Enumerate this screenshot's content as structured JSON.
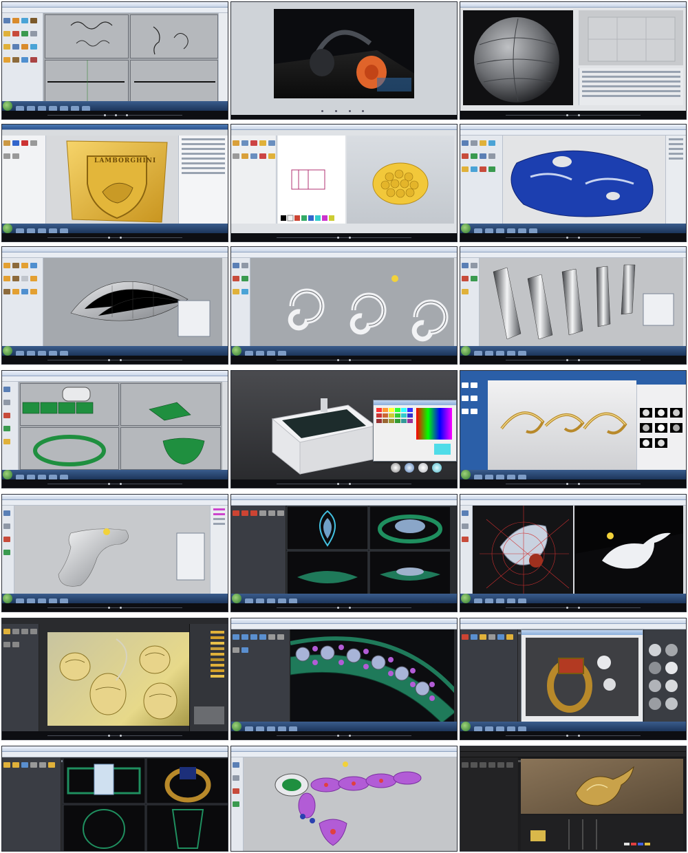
{
  "collage": {
    "columns": 3,
    "rows": 7,
    "tiles": [
      {
        "app": "Rhino",
        "subject": "ornament curves",
        "viewport_background": "#b6b8bb"
      },
      {
        "app": "Render window",
        "subject": "headphones",
        "viewport_background": "#0b0c0f"
      },
      {
        "app": "ZBrush",
        "subject": "sculpted sphere",
        "viewport_background": "#1a1a1c"
      },
      {
        "app": "ArtCAM",
        "subject": "relief logo",
        "viewport_background": "#d9dcdf",
        "embossed_text": "LAMBORGHINI"
      },
      {
        "app": "ArtCAM",
        "subject": "gold disc relief",
        "viewport_background": "#dfe2e6"
      },
      {
        "app": "Rhino",
        "subject": "blue ring",
        "viewport_background": "#e3e4e6"
      },
      {
        "app": "Rhino",
        "subject": "shell surface",
        "viewport_background": "#a7aaae"
      },
      {
        "app": "Rhino",
        "subject": "spiral shapes",
        "viewport_background": "#b3b5b8"
      },
      {
        "app": "Rhino",
        "subject": "twisted ribbons",
        "viewport_background": "#c2c4c7"
      },
      {
        "app": "Rhino",
        "subject": "green ring pieces",
        "viewport_background": "#a9acb0"
      },
      {
        "app": "Render",
        "subject": "bathtub",
        "viewport_background": "#3a3b3f"
      },
      {
        "app": "Render",
        "subject": "gold scrollwork",
        "viewport_background": "#e6e6e8"
      },
      {
        "app": "Rhino",
        "subject": "grip surface",
        "viewport_background": "#c7c9cc"
      },
      {
        "app": "Matrix",
        "subject": "pendant layout",
        "viewport_background": "#0b0b0d"
      },
      {
        "app": "Rhino",
        "subject": "bull head render",
        "viewport_background": "#0a0a0a"
      },
      {
        "app": "KeyShot",
        "subject": "filigree rings",
        "viewport_background": "#2a2b2e"
      },
      {
        "app": "Matrix",
        "subject": "gem band",
        "viewport_background": "#0c0d10"
      },
      {
        "app": "Render",
        "subject": "gold ring",
        "viewport_background": "#3b3d42"
      },
      {
        "app": "Matrix",
        "subject": "ring in four views",
        "viewport_background": "#0a0a0c"
      },
      {
        "app": "Matrix",
        "subject": "pendant chain",
        "viewport_background": "#c4c6c9"
      },
      {
        "app": "Render",
        "subject": "gold figure on stone",
        "viewport_background": "#1c1c1e"
      }
    ]
  },
  "colors": {
    "taskbar": "#2a4a78",
    "ui_panel": "#e4e8ee",
    "gold": "#e3b63a",
    "green_wire": "#1f8f3f",
    "blue_model": "#1c3fb0",
    "purple": "#b25cd6"
  }
}
